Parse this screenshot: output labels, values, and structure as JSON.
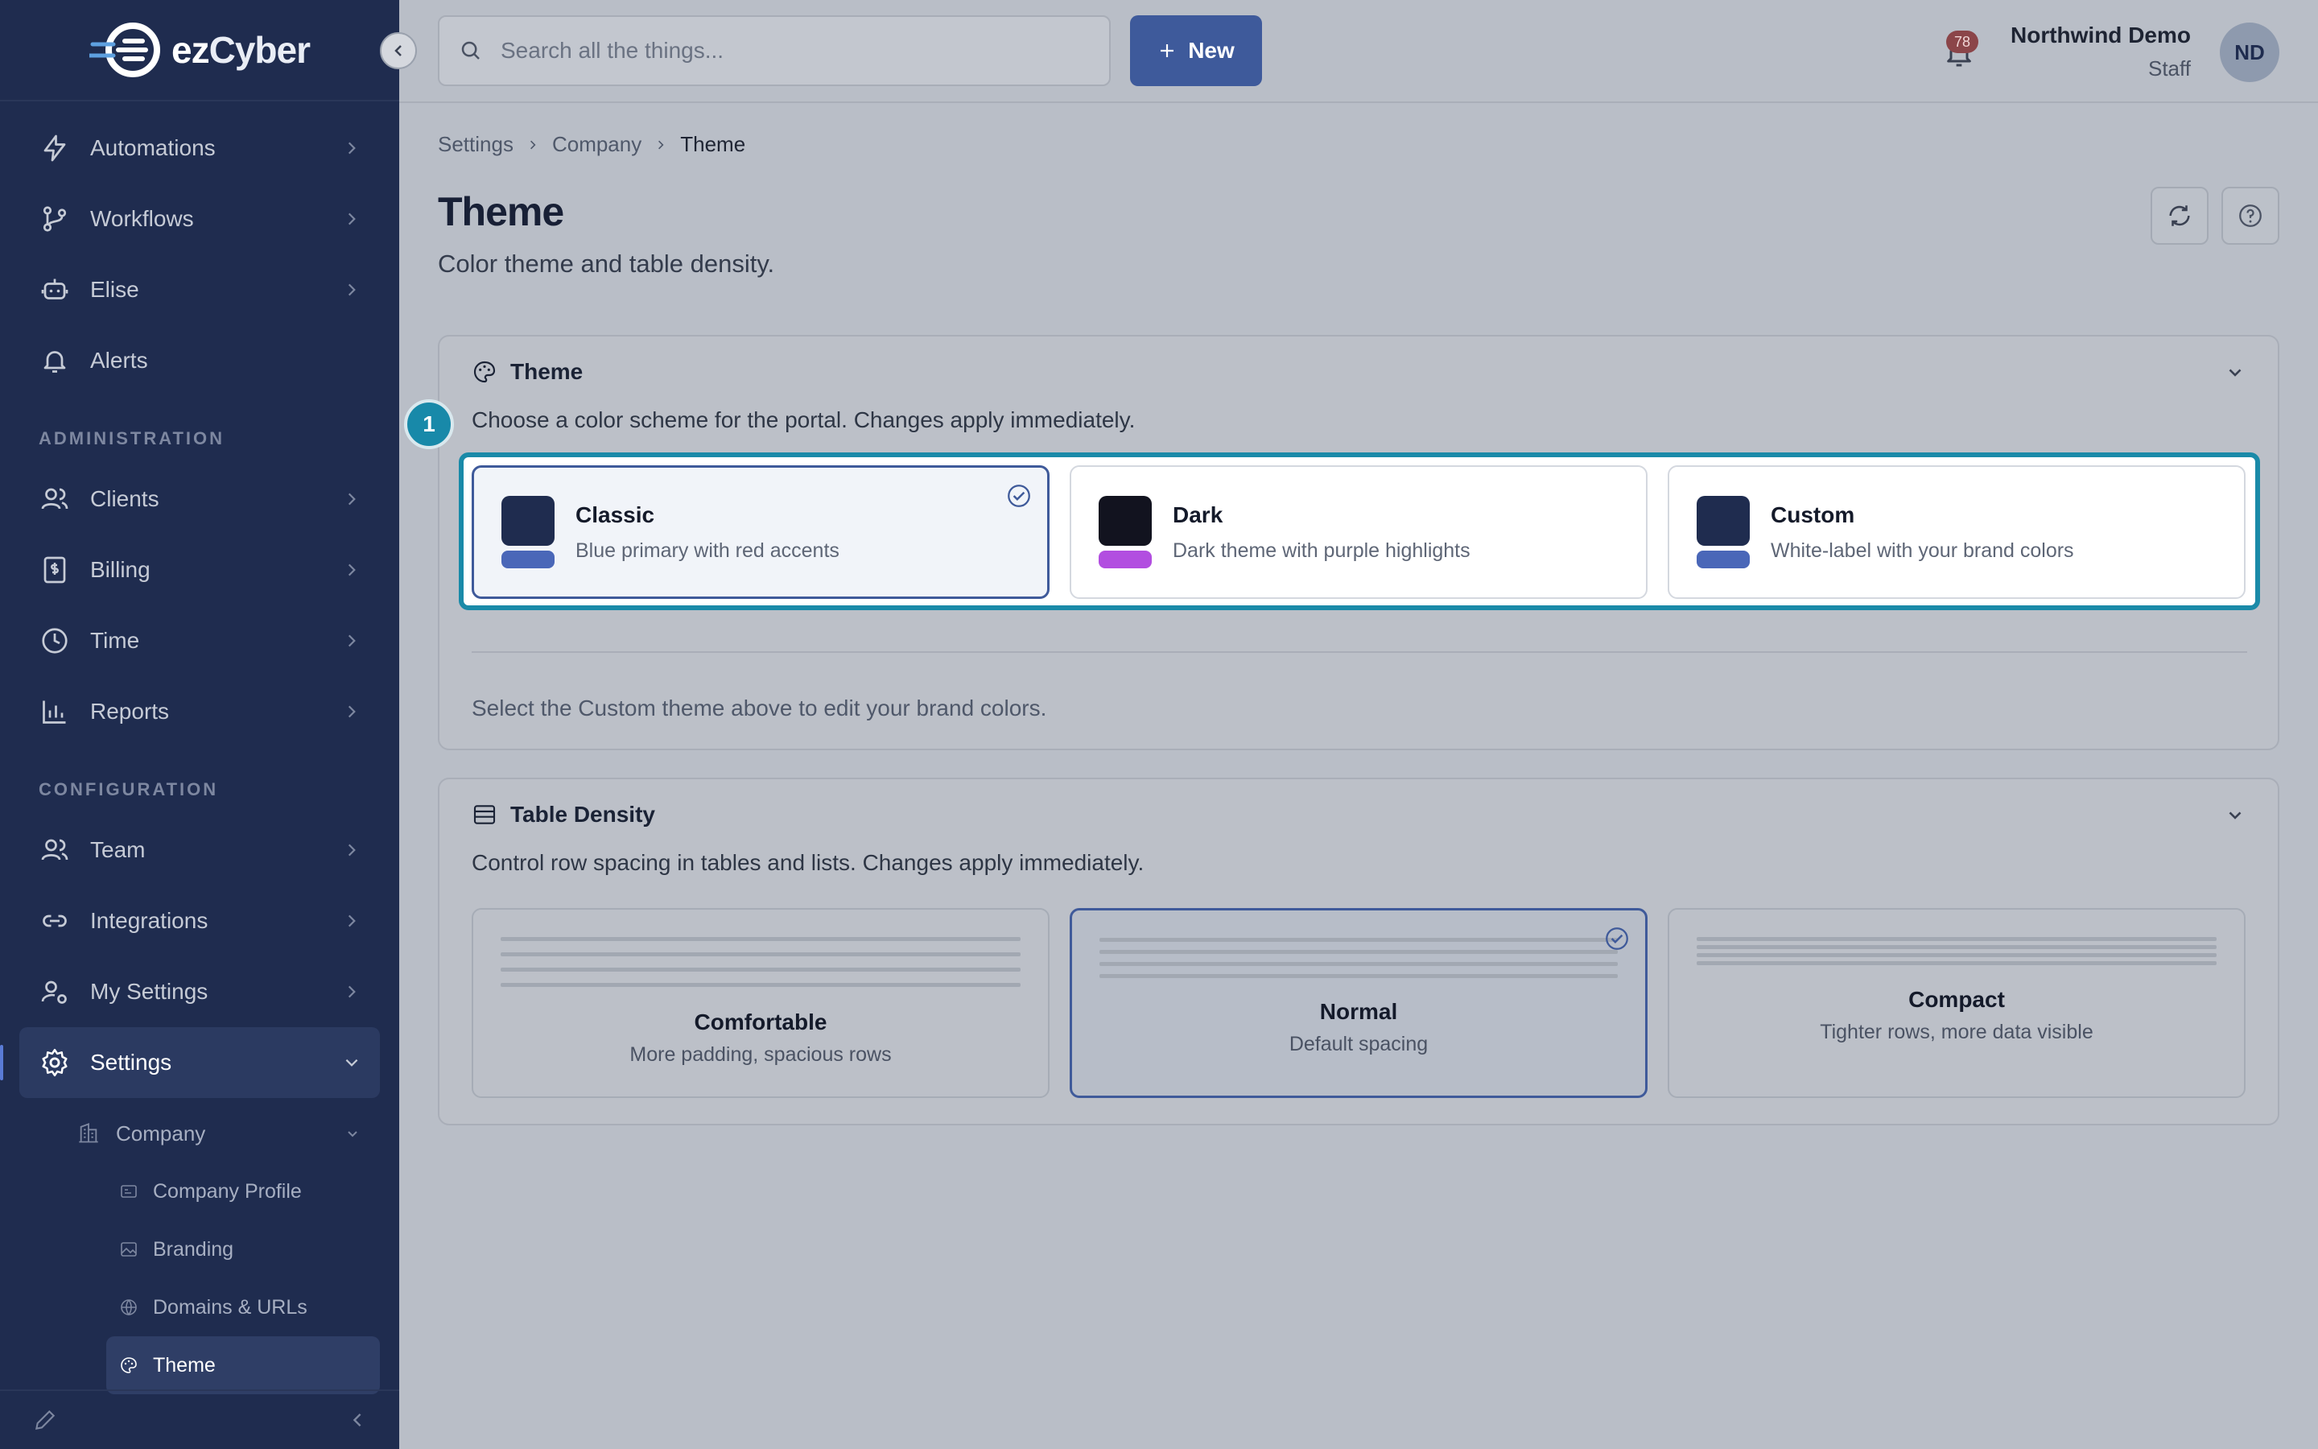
{
  "brand": {
    "logo_prefix": "ez",
    "logo_suffix": "Cyber"
  },
  "sidebar": {
    "items": [
      {
        "label": "Automations",
        "icon": "bolt-icon"
      },
      {
        "label": "Workflows",
        "icon": "branch-icon"
      },
      {
        "label": "Elise",
        "icon": "robot-icon"
      },
      {
        "label": "Alerts",
        "icon": "bell-icon"
      }
    ],
    "admin_title": "ADMINISTRATION",
    "admin_items": [
      {
        "label": "Clients",
        "icon": "users-icon"
      },
      {
        "label": "Billing",
        "icon": "dollar-icon"
      },
      {
        "label": "Time",
        "icon": "clock-icon"
      },
      {
        "label": "Reports",
        "icon": "chart-icon"
      }
    ],
    "config_title": "CONFIGURATION",
    "config_items": [
      {
        "label": "Team",
        "icon": "team-icon"
      },
      {
        "label": "Integrations",
        "icon": "link-icon"
      },
      {
        "label": "My Settings",
        "icon": "user-gear-icon"
      },
      {
        "label": "Settings",
        "icon": "gear-icon"
      }
    ],
    "company": "Company",
    "company_children": [
      "Company Profile",
      "Branding",
      "Domains & URLs",
      "Theme"
    ]
  },
  "topbar": {
    "search_placeholder": "Search all the things...",
    "new_label": "New",
    "notification_count": "78",
    "user_name": "Northwind Demo",
    "user_role": "Staff",
    "avatar_initials": "ND"
  },
  "breadcrumb": [
    "Settings",
    "Company",
    "Theme"
  ],
  "page": {
    "title": "Theme",
    "subtitle": "Color theme and table density."
  },
  "theme_card": {
    "title": "Theme",
    "description": "Choose a color scheme for the portal. Changes apply immediately.",
    "step": "1",
    "options": [
      {
        "title": "Classic",
        "desc": "Blue primary with red accents",
        "top": "#1f2c4f",
        "bottom": "#4a67b8",
        "selected": true
      },
      {
        "title": "Dark",
        "desc": "Dark theme with purple highlights",
        "top": "#12131f",
        "bottom": "#b24ee0",
        "selected": false
      },
      {
        "title": "Custom",
        "desc": "White-label with your brand colors",
        "top": "#1f2c4f",
        "bottom": "#4a67b8",
        "selected": false
      }
    ],
    "hint": "Select the Custom theme above to edit your brand colors."
  },
  "density_card": {
    "title": "Table Density",
    "description": "Control row spacing in tables and lists. Changes apply immediately.",
    "options": [
      {
        "title": "Comfortable",
        "desc": "More padding, spacious rows",
        "selected": false
      },
      {
        "title": "Normal",
        "desc": "Default spacing",
        "selected": true
      },
      {
        "title": "Compact",
        "desc": "Tighter rows, more data visible",
        "selected": false
      }
    ]
  },
  "colors": {
    "sidebar": "#1f2c4f",
    "accent": "#3e5a9b",
    "highlight": "#1a8aa8"
  }
}
